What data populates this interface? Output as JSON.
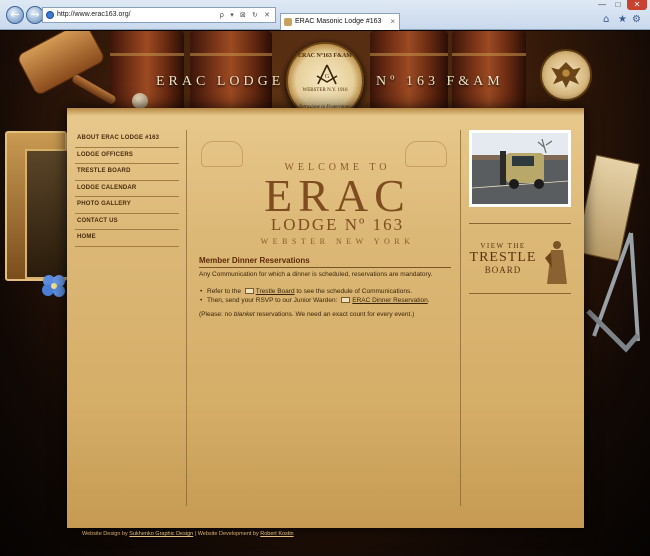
{
  "browser": {
    "back_glyph": "←",
    "forward_glyph": "→",
    "url": "http://www.erac163.org/",
    "address_tools": "ρ ▾ ⊠ ↻ ✕",
    "tab_title": "ERAC Masonic Lodge #163",
    "tab_close": "×",
    "min_glyph": "—",
    "max_glyph": "□",
    "close_glyph": "✕",
    "home_glyph": "⌂",
    "star_glyph": "★",
    "gear_glyph": "⚙"
  },
  "header": {
    "left_text": "ERAC LODGE",
    "right_text": "Nº 163 F&AM",
    "seal_top": "ERAC Nº163 F&AM",
    "seal_mid": "WEBSTER N.Y. 1916",
    "seal_motto": "Intrusione in Fraternitate"
  },
  "nav": {
    "items": [
      {
        "label": "ABOUT ERAC LODGE #163"
      },
      {
        "label": "LODGE OFFICERS"
      },
      {
        "label": "TRESTLE BOARD"
      },
      {
        "label": "LODGE CALENDAR"
      },
      {
        "label": "PHOTO GALLERY"
      },
      {
        "label": "CONTACT US"
      },
      {
        "label": "HOME"
      }
    ]
  },
  "welcome": {
    "line1": "WELCOME TO",
    "line2": "ERAC",
    "line3": "LODGE Nº 163",
    "line4": "WEBSTER  NEW YORK"
  },
  "content": {
    "heading": "Member Dinner Reservations",
    "intro": "Any Communication for which a dinner is scheduled, reservations are mandatory.",
    "bullet1_pre": "Refer to the",
    "bullet1_link": "Trestle Board",
    "bullet1_post": "to see the schedule of Communications.",
    "bullet2_pre": "Then, send your RSVP to our Junior Warden:",
    "bullet2_link": "ERAC Dinner Reservation",
    "bullet2_post": ".",
    "note_pre": "(Please: no",
    "note_em": "blanket",
    "note_post": "reservations. We need an exact count for every event.)"
  },
  "sidebar": {
    "trestle_view": "VIEW THE",
    "trestle_title": "TRESTLE",
    "trestle_board": "BOARD"
  },
  "footer": {
    "design_pre": "Website Design by",
    "design_link": "Sukhenko Graphic Design",
    "sep": "|",
    "dev_pre": "Website Development by",
    "dev_link": "Robert Kostin"
  }
}
